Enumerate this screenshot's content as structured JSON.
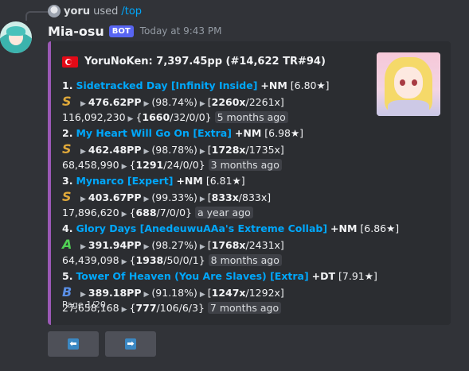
{
  "reply": {
    "user": "yoru",
    "used_text": "used",
    "command": "/top"
  },
  "message": {
    "username": "Mia-osu",
    "bot_badge": "BOT",
    "timestamp": "Today at 9:43 PM"
  },
  "embed": {
    "author": "YoruNoKen: 7,397.45pp (#14,622 TR#94)",
    "flag_icon": "turkey-flag-icon",
    "accent_color": "#9b59b6",
    "footer": "Page 1/20",
    "scores": [
      {
        "index": "1.",
        "title": "Sidetracked Day [Infinity Inside]",
        "mods": "+NM",
        "stars": "[6.80★]",
        "rank": "S",
        "pp": "476.62PP",
        "acc": "(98.74%)",
        "combo_open": "[",
        "combo": "2260x",
        "combo_max": "/2261x]",
        "score": "116,092,230",
        "hits_open": "{",
        "hits_300": "1660",
        "hits_rest": "/32/0/0}",
        "ago": "5 months ago"
      },
      {
        "index": "2.",
        "title": "My Heart Will Go On [Extra]",
        "mods": "+NM",
        "stars": "[6.98★]",
        "rank": "S",
        "pp": "462.48PP",
        "acc": "(98.78%)",
        "combo_open": "[",
        "combo": "1728x",
        "combo_max": "/1735x]",
        "score": "68,458,990",
        "hits_open": "{",
        "hits_300": "1291",
        "hits_rest": "/24/0/0}",
        "ago": "3 months ago"
      },
      {
        "index": "3.",
        "title": "Mynarco [Expert]",
        "mods": "+NM",
        "stars": "[6.81★]",
        "rank": "S",
        "pp": "403.67PP",
        "acc": "(99.33%)",
        "combo_open": "[",
        "combo": "833x",
        "combo_max": "/833x]",
        "score": "17,896,620",
        "hits_open": "{",
        "hits_300": "688",
        "hits_rest": "/7/0/0}",
        "ago": "a year ago"
      },
      {
        "index": "4.",
        "title": "Glory Days [AnedeuwuAAa's Extreme Collab]",
        "mods": "+NM",
        "stars": "[6.86★]",
        "rank": "A",
        "pp": "391.94PP",
        "acc": "(98.27%)",
        "combo_open": "[",
        "combo": "1768x",
        "combo_max": "/2431x]",
        "score": "64,439,098",
        "hits_open": "{",
        "hits_300": "1938",
        "hits_rest": "/50/0/1}",
        "ago": "8 months ago"
      },
      {
        "index": "5.",
        "title": "Tower Of Heaven (You Are Slaves) [Extra]",
        "mods": "+DT",
        "stars": "[7.91★]",
        "rank": "B",
        "pp": "389.18PP",
        "acc": "(91.18%)",
        "combo_open": "[",
        "combo": "1247x",
        "combo_max": "/1292x]",
        "score": "27,658,168",
        "hits_open": "{",
        "hits_300": "777",
        "hits_rest": "/106/6/3}",
        "ago": "7 months ago"
      }
    ]
  },
  "buttons": {
    "prev_icon": "left-arrow-icon",
    "prev_glyph": "⬅",
    "next_icon": "right-arrow-icon",
    "next_glyph": "➡",
    "color": "#3b88c3"
  },
  "separator_glyph": "▶"
}
